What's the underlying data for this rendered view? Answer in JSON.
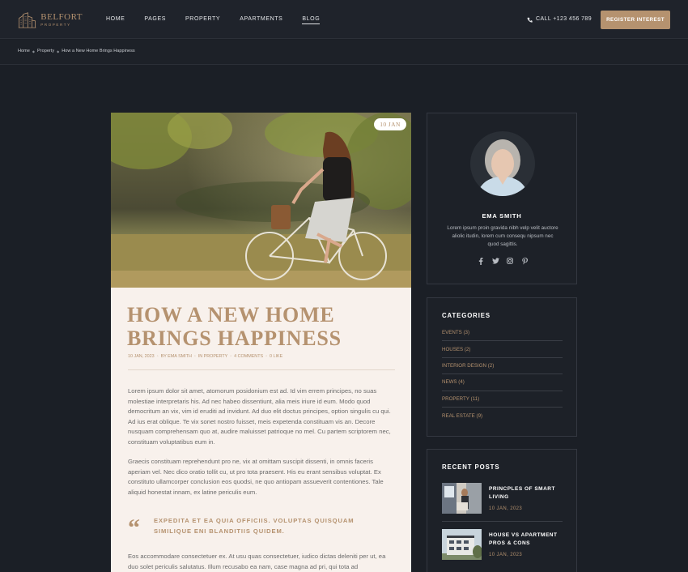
{
  "header": {
    "brand": "BELFORT",
    "brand_sub": "PROPERTY",
    "nav": [
      "HOME",
      "PAGES",
      "PROPERTY",
      "APARTMENTS",
      "BLOG"
    ],
    "active_nav": "BLOG",
    "phone": "CALL +123 456 789",
    "register_label": "REGISTER INTEREST"
  },
  "breadcrumb": [
    "Home",
    "Property",
    "How a New Home Brings Happiness"
  ],
  "post": {
    "date_badge": "10 JAN",
    "title": "HOW A NEW HOME BRINGS HAPPINESS",
    "meta": [
      "10 JAN, 2023",
      "BY EMA SMITH",
      "IN PROPERTY",
      "4 COMMENTS",
      "0 LIKE"
    ],
    "paragraphs": [
      "Lorem ipsum dolor sit amet, atomorum posidonium est ad. Id vim errem principes, no suas molestiae interpretaris his. Ad nec habeo dissentiunt, alia meis iriure id eum. Modo quod democritum an vix, vim id eruditi ad invidunt. Ad duo elit doctus principes, option singulis cu qui. Ad ius erat oblique. Te vix sonet nostro fuisset, meis expetenda constituam vis an. Decore nusquam comprehensam quo at, audire maluisset patrioque no mel. Cu partem scriptorem nec, constituam voluptatibus eum in.",
      "Graecis constituam reprehendunt pro ne, vix at omittam suscipit dissenti, in omnis faceris aperiam vel. Nec dico oratio tollit cu, ut pro tota praesent. His eu erant sensibus voluptat. Ex constituto ullamcorper conclusion eos quodsi, ne quo antiopam assueverit contentiones. Tale aliquid honestat innam, ex latine periculis eum.",
      "Eos accommodare consectetuer ex. At usu quas consectetuer, iudico dictas deleniti per ut, ea duo solet periculis salutatus. Illum recusabo ea nam, case magna ad pri, qui tota ad"
    ],
    "quote": "EXPEDITA ET EA QUIA OFFICIIS. VOLUPTAS QUISQUAM SIMILIQUE ENI BLANDITIIS QUIDEM."
  },
  "author": {
    "name": "EMA SMITH",
    "bio": "Lorem ipsum proin gravida nibh velp velit auctore aliolic itudin, lorem cum consequ nipsum nec quod sagittis.",
    "socials": [
      "facebook-icon",
      "twitter-icon",
      "instagram-icon",
      "pinterest-icon"
    ]
  },
  "categories": {
    "heading": "CATEGORIES",
    "items": [
      {
        "name": "EVENTS",
        "count": "(3)"
      },
      {
        "name": "HOUSES",
        "count": "(2)"
      },
      {
        "name": "INTERIOR DESIGN",
        "count": "(2)"
      },
      {
        "name": "NEWS",
        "count": "(4)"
      },
      {
        "name": "PROPERTY",
        "count": "(11)"
      },
      {
        "name": "REAL ESTATE",
        "count": "(9)"
      }
    ]
  },
  "recent": {
    "heading": "RECENT POSTS",
    "items": [
      {
        "title": "PRINCPLES OF SMART LIVING",
        "date": "10 JAN, 2023"
      },
      {
        "title": "HOUSE VS APARTMENT PROS & CONS",
        "date": "10 JAN, 2023"
      }
    ]
  },
  "colors": {
    "accent": "#b5926f",
    "background": "#1b1f26",
    "article_bg": "#f8f1ec"
  }
}
